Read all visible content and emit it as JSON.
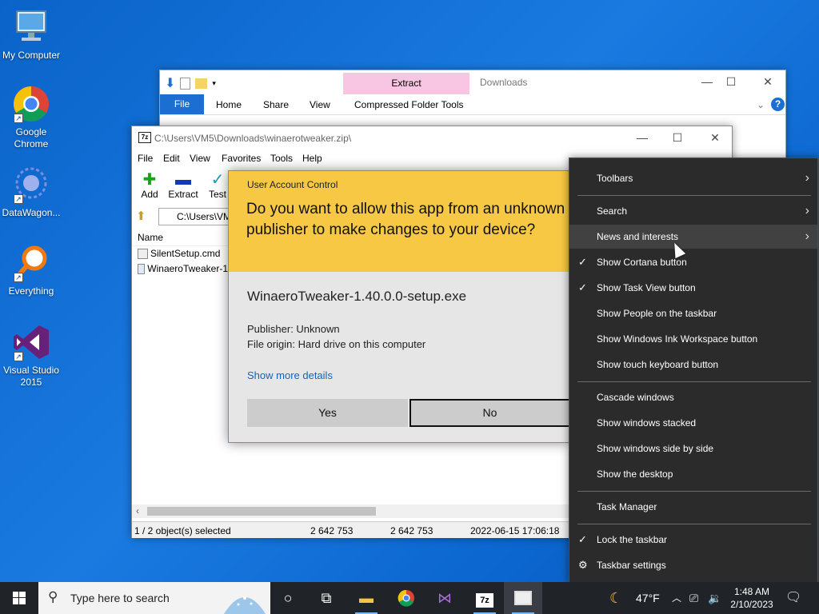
{
  "desktop": {
    "icons": [
      {
        "label": "My Computer"
      },
      {
        "label": "Google Chrome"
      },
      {
        "label": "DataWagon..."
      },
      {
        "label": "Everything"
      },
      {
        "label": "Visual Studio 2015"
      }
    ]
  },
  "explorer": {
    "title": "Downloads",
    "context_tab": "Extract",
    "ribbon_tabs": [
      "File",
      "Home",
      "Share",
      "View",
      "Compressed Folder Tools"
    ],
    "help_icon": "?"
  },
  "sevenzip": {
    "title": "C:\\Users\\VM5\\Downloads\\winaerotweaker.zip\\",
    "logo": "7z",
    "menu": [
      "File",
      "Edit",
      "View",
      "Favorites",
      "Tools",
      "Help"
    ],
    "toolbar": [
      {
        "label": "Add",
        "icon": "add-plus-icon"
      },
      {
        "label": "Extract",
        "icon": "extract-minus-icon"
      },
      {
        "label": "Test",
        "icon": "test-check-icon"
      }
    ],
    "address": "C:\\Users\\VM",
    "column_name": "Name",
    "files": [
      "SilentSetup.cmd",
      "WinaeroTweaker-1"
    ],
    "status": {
      "selected": "1 / 2 object(s) selected",
      "size": "2 642 753",
      "packed": "2 642 753",
      "modified": "2022-06-15 17:06:18"
    }
  },
  "uac": {
    "header": "User Account Control",
    "question": "Do you want to allow this app from an unknown publisher to make changes to your device?",
    "app_name": "WinaeroTweaker-1.40.0.0-setup.exe",
    "publisher": "Publisher: Unknown",
    "origin": "File origin: Hard drive on this computer",
    "more_details": "Show more details",
    "yes": "Yes",
    "no": "No"
  },
  "context_menu": {
    "toolbars": "Toolbars",
    "search": "Search",
    "news": "News and interests",
    "cortana": "Show Cortana button",
    "task_view": "Show Task View button",
    "people": "Show People on the taskbar",
    "ink": "Show Windows Ink Workspace button",
    "touch_kb": "Show touch keyboard button",
    "cascade": "Cascade windows",
    "stacked": "Show windows stacked",
    "side_by_side": "Show windows side by side",
    "desktop": "Show the desktop",
    "task_manager": "Task Manager",
    "lock": "Lock the taskbar",
    "settings": "Taskbar settings"
  },
  "taskbar": {
    "search_placeholder": "Type here to search",
    "weather": "47°F",
    "time": "1:48 AM",
    "date": "2/10/2023",
    "pinned": [
      "cortana-circle-icon",
      "task-view-icon",
      "file-explorer-icon",
      "chrome-icon",
      "visual-studio-icon",
      "sevenzip-icon",
      "app-window-icon"
    ]
  }
}
